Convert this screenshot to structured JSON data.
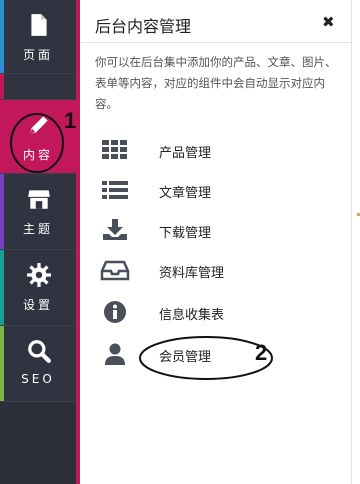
{
  "sidebar": {
    "items": [
      {
        "label": "页面",
        "icon": "page-icon",
        "accent": "#2d8fd5"
      },
      {
        "label": "内容",
        "icon": "pencil-icon",
        "accent": "#c2185b",
        "active": true
      },
      {
        "label": "主题",
        "icon": "store-icon",
        "accent": "#7b3fc4"
      },
      {
        "label": "设置",
        "icon": "gear-icon",
        "accent": "#1a9e96"
      },
      {
        "label": "SEO",
        "icon": "search-icon",
        "accent": "#7cb342"
      }
    ]
  },
  "panel": {
    "title": "后台内容管理",
    "close_label": "✖",
    "description": "你可以在后台集中添加你的产品、文章、图片、表单等内容，对应的组件中会自动显示对应内容。",
    "items": [
      {
        "label": "产品管理",
        "icon": "grid-icon"
      },
      {
        "label": "文章管理",
        "icon": "list-icon"
      },
      {
        "label": "下载管理",
        "icon": "download-icon"
      },
      {
        "label": "资料库管理",
        "icon": "inbox-icon"
      },
      {
        "label": "信息收集表",
        "icon": "info-icon"
      },
      {
        "label": "会员管理",
        "icon": "user-icon"
      }
    ]
  },
  "annotations": {
    "step1": "1",
    "step2": "2"
  },
  "colors": {
    "accent": "#c2185b",
    "sidebar_bg": "#2f3440",
    "icon_gray": "#4a4f5a"
  }
}
